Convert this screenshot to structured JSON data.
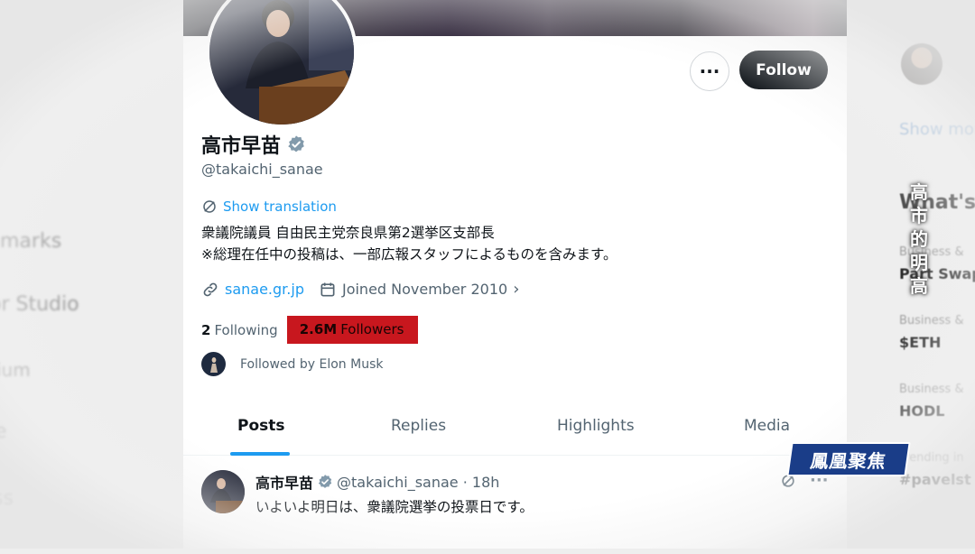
{
  "left_nav": {
    "items": [
      "marks",
      "or Studio",
      "ium",
      "e",
      "ss"
    ]
  },
  "profile": {
    "display_name": "高市早苗",
    "handle": "@takaichi_sanae",
    "more_label": "···",
    "follow_label": "Follow",
    "show_translation": "Show translation",
    "bio_line1": "衆議院議員 自由民主党奈良県第2選挙区支部長",
    "bio_line2": "※総理在任中の投稿は、一部広報スタッフによるものを含みます。",
    "website": "sanae.gr.jp",
    "joined": "Joined November 2010",
    "following_count": "2",
    "following_label": "Following",
    "followers_count": "2.6M",
    "followers_label": "Followers",
    "followed_by": "Followed by Elon Musk"
  },
  "tabs": [
    "Posts",
    "Replies",
    "Highlights",
    "Media"
  ],
  "active_tab": "Posts",
  "tweet": {
    "name": "高市早苗",
    "handle_time": "@takaichi_sanae · 18h",
    "text": "いよいよ明日は、衆議院選挙の投票日です。",
    "more_label": "···"
  },
  "right_rail": {
    "show_more": "Show more",
    "whats_happening": "What's",
    "trends": [
      {
        "category": "Business & ",
        "name": "Part Swap"
      },
      {
        "category": "Business & ",
        "name": "$ETH"
      },
      {
        "category": "Business & ",
        "name": "HODL"
      },
      {
        "category": "Trending in",
        "name": "#pavelst"
      }
    ],
    "vertical_caption": "高市的明高"
  },
  "watermark": "鳳凰聚焦",
  "colors": {
    "accent": "#1d9bf0",
    "follow_bg": "#0f1419",
    "highlight": "#c8171e",
    "watermark_bg": "#1a3d88"
  }
}
